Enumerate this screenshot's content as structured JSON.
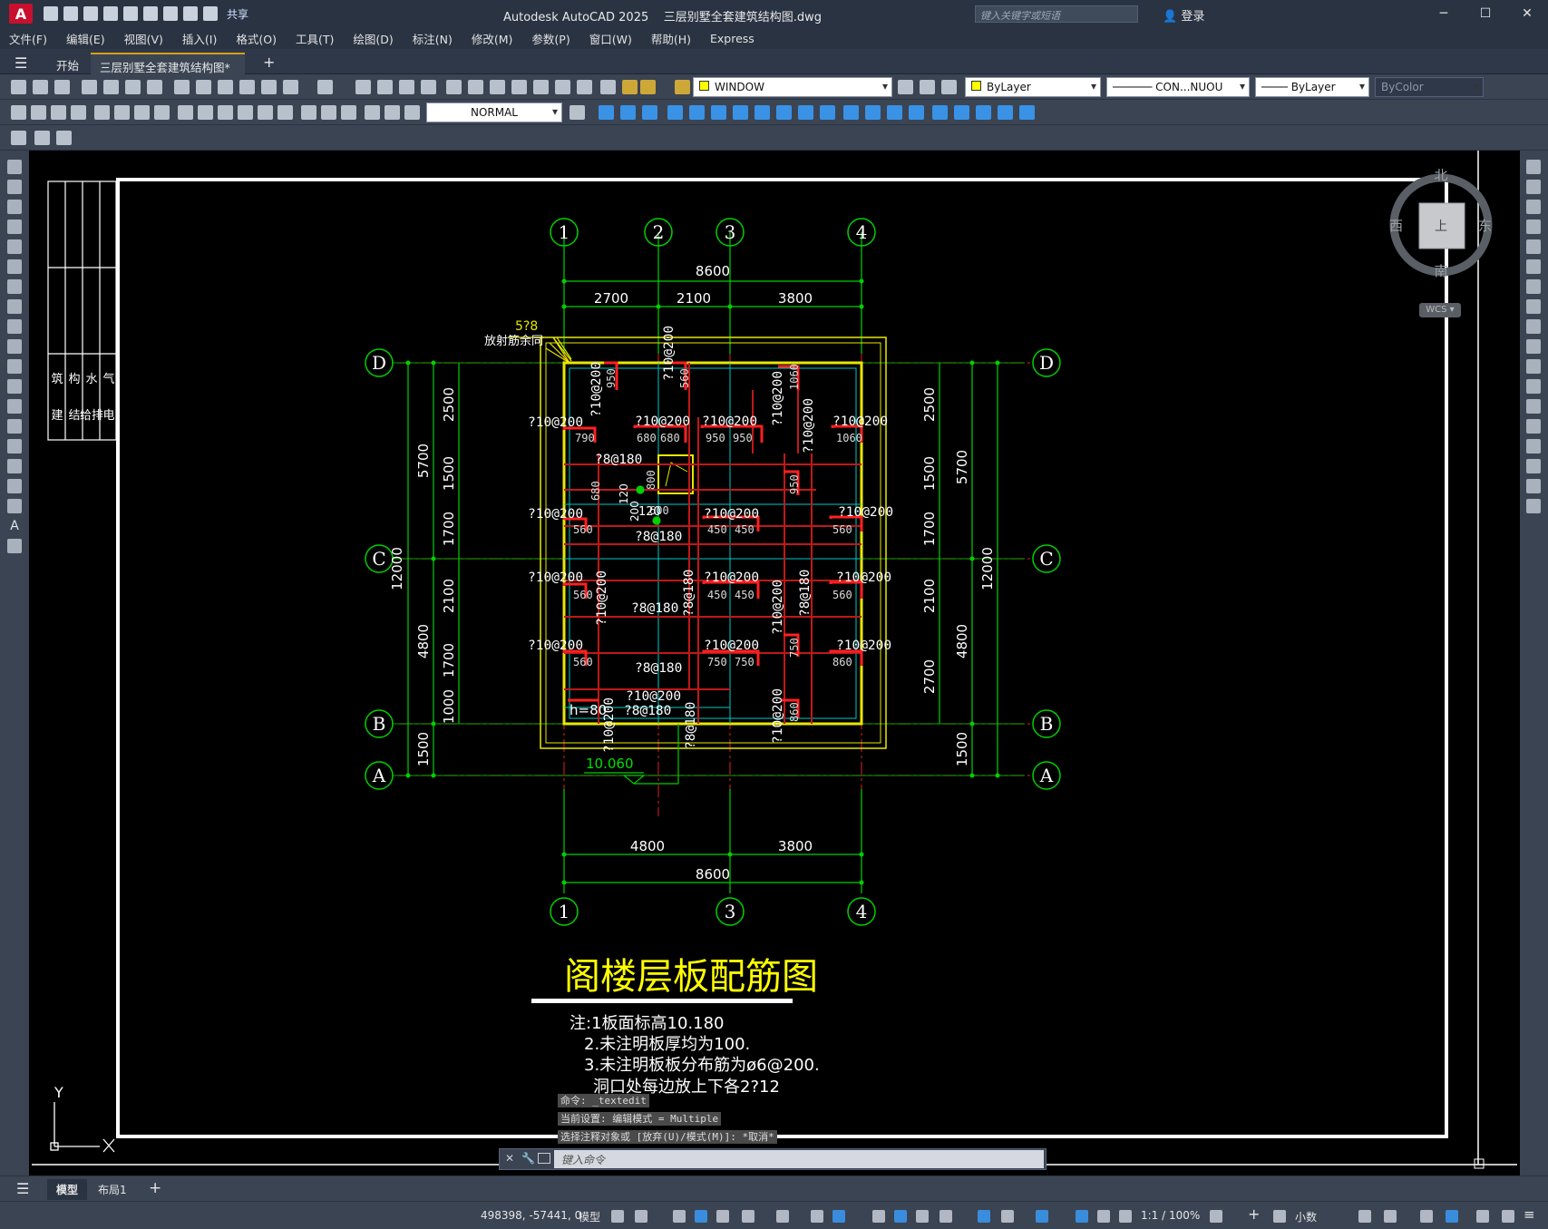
{
  "app": {
    "logo": "A",
    "title": "Autodesk AutoCAD 2025",
    "document": "三层别墅全套建筑结构图.dwg",
    "share": "共享",
    "search_placeholder": "键入关键字或短语",
    "login": "登录"
  },
  "window_controls": {
    "minimize": "─",
    "maximize": "☐",
    "close": "✕"
  },
  "menu": [
    "文件(F)",
    "编辑(E)",
    "视图(V)",
    "插入(I)",
    "格式(O)",
    "工具(T)",
    "绘图(D)",
    "标注(N)",
    "修改(M)",
    "参数(P)",
    "窗口(W)",
    "帮助(H)",
    "Express"
  ],
  "tabs": {
    "start": "开始",
    "active": "三层别墅全套建筑结构图*",
    "close": "✕",
    "add": "+"
  },
  "toolbar": {
    "view_combo": "WINDOW",
    "layer": "ByLayer",
    "linetype": "CON...NUOU",
    "lineweight": "ByLayer",
    "plotstyle": "ByColor",
    "style_combo": "NORMAL"
  },
  "compass": {
    "north": "北",
    "south": "南",
    "east": "东",
    "west": "西",
    "top": "上",
    "wcs": "WCS"
  },
  "drawing": {
    "grid_top": [
      "1",
      "2",
      "3",
      "4"
    ],
    "grid_bottom": [
      "1",
      "3",
      "4"
    ],
    "grid_left": [
      "D",
      "C",
      "B",
      "A"
    ],
    "grid_right": [
      "D",
      "C",
      "B",
      "A"
    ],
    "dim_top_total": "8600",
    "dim_top": [
      "2700",
      "2100",
      "3800"
    ],
    "dim_bottom": [
      "4800",
      "3800"
    ],
    "dim_bottom_total": "8600",
    "dim_left_total": "12000",
    "dim_left_mid": [
      "5700",
      "4800",
      "1500"
    ],
    "dim_left_inner": [
      "2500",
      "1500",
      "1700",
      "2100",
      "1700",
      "1000"
    ],
    "dim_right_inner": [
      "2500",
      "1500",
      "1700",
      "2100",
      "2700"
    ],
    "dim_right_mid": [
      "5700",
      "4800",
      "1500"
    ],
    "dim_right_total": "12000",
    "rebar": [
      "?10@200",
      "?8@180",
      "?10@200",
      "?8@180",
      "?10@200",
      "?10@200",
      "?10@200",
      "?8@180",
      "?10@200",
      "?10@200",
      "?8@180",
      "?10@200",
      "?10@200",
      "?10@200",
      "?10@200"
    ],
    "bar_lengths": [
      "790",
      "680",
      "680",
      "950",
      "950",
      "1060",
      "560",
      "450",
      "450",
      "560",
      "560",
      "450",
      "450",
      "560",
      "560",
      "750",
      "750",
      "860",
      "800",
      "600"
    ],
    "labels": {
      "radial": "放射筋余同",
      "radial_count": "5?8",
      "elevation": "10.060",
      "thickness": "h=80",
      "l120": "120",
      "l2001": "200",
      "l1202": "120"
    },
    "title": "阁楼层板配筋图",
    "notes": [
      "注:1板面标高10.180",
      "2.未注明板厚均为100.",
      "3.未注明板板分布筋为ø6@200.",
      "洞口处每边放上下各2?12"
    ],
    "side_table": [
      "筑",
      "构",
      "水",
      "气",
      "建",
      "结",
      "给排",
      "电"
    ],
    "ucs_y": "Y"
  },
  "command": {
    "lines": [
      "命令:  _textedit",
      "当前设置: 编辑模式 = Multiple",
      "选择注释对象或 [放弃(U)/模式(M)]: *取消*"
    ],
    "placeholder": "键入命令"
  },
  "layout_tabs": [
    "模型",
    "布局1",
    "+"
  ],
  "status": {
    "coords": "498398, -57441, 0",
    "model": "模型",
    "scale": "1:1 / 100%",
    "units": "小数"
  }
}
